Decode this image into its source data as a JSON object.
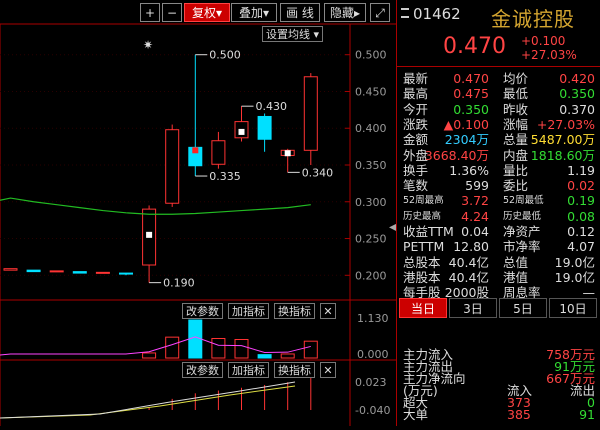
{
  "toolbar": {
    "plus": "+",
    "minus": "−",
    "restore": "复权",
    "restore_arrow": "▾",
    "overlay": "叠加",
    "overlay_arrow": "▾",
    "draw": "画 线",
    "hide": "隐藏",
    "hide_arrow": "▸",
    "expand": "⤢"
  },
  "chart": {
    "ma_setting": "设置均线",
    "ma_setting_arrow": "▾",
    "y_ticks": [
      "0.500",
      "0.450",
      "0.400",
      "0.350",
      "0.300",
      "0.250",
      "0.200"
    ],
    "sub1_ticks": [
      "1.130",
      "0.000"
    ],
    "sub2_ticks": [
      "0.023",
      "-0.040"
    ],
    "annot_high": "0.500",
    "annot_a": "0.335",
    "annot_b": "0.430",
    "annot_c": "0.340",
    "annot_low": "0.190",
    "sub_buttons": [
      "改参数",
      "加指标",
      "换指标"
    ],
    "close_x": "✕",
    "star": "✷",
    "colors": {
      "up": "#ff3333",
      "down": "#00e0ff",
      "ma": "#22bb22",
      "macd": "#ff44ff"
    }
  },
  "chart_data": {
    "type": "candlestick",
    "candles": [
      {
        "open": 0.207,
        "close": 0.209,
        "high": 0.209,
        "low": 0.207
      },
      {
        "open": 0.207,
        "close": 0.205,
        "high": 0.207,
        "low": 0.205
      },
      {
        "open": 0.206,
        "close": 0.206,
        "high": 0.206,
        "low": 0.205
      },
      {
        "open": 0.205,
        "close": 0.203,
        "high": 0.205,
        "low": 0.203
      },
      {
        "open": 0.204,
        "close": 0.204,
        "high": 0.204,
        "low": 0.203
      },
      {
        "open": 0.203,
        "close": 0.202,
        "high": 0.203,
        "low": 0.2
      },
      {
        "open": 0.214,
        "close": 0.29,
        "high": 0.295,
        "low": 0.19
      },
      {
        "open": 0.298,
        "close": 0.398,
        "high": 0.405,
        "low": 0.293
      },
      {
        "open": 0.374,
        "close": 0.349,
        "high": 0.5,
        "low": 0.335
      },
      {
        "open": 0.351,
        "close": 0.383,
        "high": 0.395,
        "low": 0.345
      },
      {
        "open": 0.387,
        "close": 0.409,
        "high": 0.43,
        "low": 0.382
      },
      {
        "open": 0.416,
        "close": 0.385,
        "high": 0.42,
        "low": 0.368
      },
      {
        "open": 0.363,
        "close": 0.37,
        "high": 0.372,
        "low": 0.34
      },
      {
        "open": 0.37,
        "close": 0.47,
        "high": 0.475,
        "low": 0.35
      }
    ],
    "ma_line": [
      0.305,
      0.3,
      0.296,
      0.292,
      0.288,
      0.285,
      0.283,
      0.283,
      0.284,
      0.286,
      0.288,
      0.29,
      0.292,
      0.296
    ],
    "volume": [
      0,
      0,
      0,
      0,
      0,
      0,
      0.15,
      0.62,
      1.13,
      0.58,
      0.55,
      0.1,
      0.12,
      0.5
    ],
    "macd_hist": [
      0,
      0,
      0,
      0,
      0,
      0,
      0.002,
      0.008,
      0.012,
      0.014,
      0.016,
      0.018,
      0.02,
      0.023
    ],
    "y_range": [
      0.18,
      0.52
    ]
  },
  "quote": {
    "code": "01462",
    "name": "金诚控股",
    "price": "0.470",
    "change": "+0.100",
    "change_pct": "+27.03%",
    "rows": [
      {
        "l": "最新",
        "v": "0.470",
        "vc": "#ff4444",
        "l2": "均价",
        "v2": "0.420",
        "vc2": "#ff4444"
      },
      {
        "l": "最高",
        "v": "0.475",
        "vc": "#ff4444",
        "l2": "最低",
        "v2": "0.350",
        "vc2": "#33dd33"
      },
      {
        "l": "今开",
        "v": "0.350",
        "vc": "#33dd33",
        "l2": "昨收",
        "v2": "0.370",
        "vc2": "#dddddd"
      },
      {
        "l": "涨跌",
        "v": "▲0.100",
        "vc": "#ff4444",
        "l2": "涨幅",
        "v2": "+27.03%",
        "vc2": "#ff4444"
      },
      {
        "l": "金额",
        "v": "2304万",
        "vc": "#33ccff",
        "l2": "总量",
        "v2": "5487.00万",
        "vc2": "#ffdd33"
      },
      {
        "l": "外盘",
        "v": "3668.40万",
        "vc": "#ff4444",
        "l2": "内盘",
        "v2": "1818.60万",
        "vc2": "#33dd33"
      },
      {
        "l": "换手",
        "v": "1.36%",
        "vc": "#dddddd",
        "l2": "量比",
        "v2": "1.19",
        "vc2": "#dddddd"
      },
      {
        "l": "笔数",
        "v": "599",
        "vc": "#dddddd",
        "l2": "委比",
        "v2": "0.02",
        "vc2": "#ff4444"
      },
      {
        "l": "52周最高",
        "v": "3.72",
        "vc": "#ff4444",
        "l2": "52周最低",
        "v2": "0.19",
        "vc2": "#33dd33",
        "small": true
      },
      {
        "l": "历史最高",
        "v": "4.24",
        "vc": "#ff4444",
        "l2": "历史最低",
        "v2": "0.08",
        "vc2": "#33dd33",
        "small": true
      },
      {
        "l": "收益TTM",
        "v": "0.04",
        "vc": "#dddddd",
        "l2": "净资产",
        "v2": "0.12",
        "vc2": "#dddddd"
      },
      {
        "l": "PETTM",
        "v": "12.80",
        "vc": "#dddddd",
        "l2": "市净率",
        "v2": "4.07",
        "vc2": "#dddddd"
      },
      {
        "l": "总股本",
        "v": "40.4亿",
        "vc": "#dddddd",
        "l2": "总值",
        "v2": "19.0亿",
        "vc2": "#dddddd"
      },
      {
        "l": "港股本",
        "v": "40.4亿",
        "vc": "#dddddd",
        "l2": "港值",
        "v2": "19.0亿",
        "vc2": "#dddddd"
      },
      {
        "l": "每手股",
        "v": "2000股",
        "vc": "#dddddd",
        "l2": "周息率",
        "v2": "—",
        "vc2": "#dddddd"
      }
    ]
  },
  "tabs": [
    "当日",
    "3日",
    "5日",
    "10日"
  ],
  "flow": {
    "rows": [
      {
        "l": "主力流入",
        "v": "758万元"
      },
      {
        "l": "主力流出",
        "v": "91万元"
      },
      {
        "l": "主力净流向",
        "v": "667万元"
      }
    ],
    "head_unit": "(万元)",
    "head_in": "流入",
    "head_out": "流出",
    "r1_label": "超大",
    "r1_in": "373",
    "r1_out": "0",
    "r2_label": "大单",
    "r2_in": "385",
    "r2_out": "91"
  }
}
